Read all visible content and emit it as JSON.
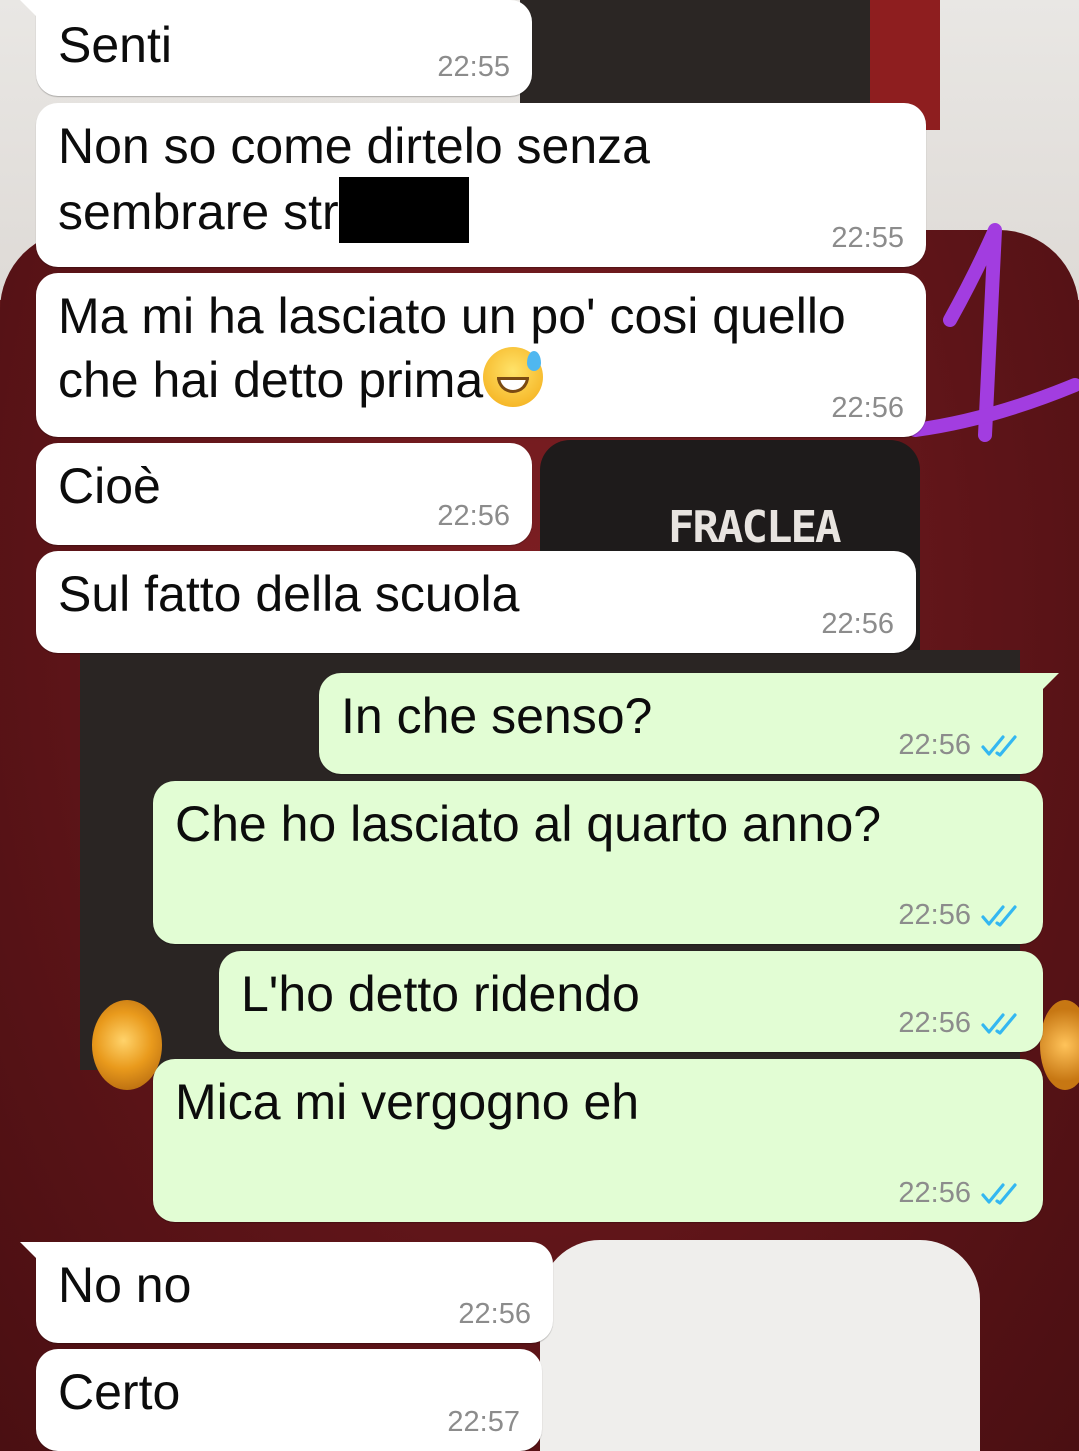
{
  "messages": [
    {
      "id": 1,
      "direction": "in",
      "text": "Senti",
      "time": "22:55"
    },
    {
      "id": 2,
      "direction": "in",
      "text_line1": "Non so come dirtelo senza",
      "text_line2": "sembrare str",
      "redacted": true,
      "time": "22:55"
    },
    {
      "id": 3,
      "direction": "in",
      "text_line1": "Ma mi ha lasciato un po' cosi quello",
      "text_line2": "che hai detto prima",
      "emoji": "grinning-sweat-emoji",
      "time": "22:56"
    },
    {
      "id": 4,
      "direction": "in",
      "text": "Cioè",
      "time": "22:56"
    },
    {
      "id": 5,
      "direction": "in",
      "text": "Sul fatto della scuola",
      "time": "22:56"
    },
    {
      "id": 6,
      "direction": "out",
      "text": "In che senso?",
      "time": "22:56",
      "status": "read"
    },
    {
      "id": 7,
      "direction": "out",
      "text": "Che ho lasciato al quarto anno?",
      "time": "22:56",
      "status": "read"
    },
    {
      "id": 8,
      "direction": "out",
      "text": "L'ho detto ridendo",
      "time": "22:56",
      "status": "read"
    },
    {
      "id": 9,
      "direction": "out",
      "text": "Mica mi vergogno eh",
      "time": "22:56",
      "status": "read"
    },
    {
      "id": 10,
      "direction": "in",
      "text": "No no",
      "time": "22:56"
    },
    {
      "id": 11,
      "direction": "in",
      "text": "Certo",
      "time": "22:57"
    }
  ],
  "wallpaper": {
    "sign_text": "FRACLEA"
  },
  "annotation": {
    "mark": "1",
    "color": "#a23de0"
  },
  "colors": {
    "incoming_bubble": "#ffffff",
    "outgoing_bubble": "#e2fdd4",
    "read_ticks": "#34b7f1",
    "time_text": "#8c8c8c"
  },
  "icons": {
    "read_status": "double-check-icon"
  }
}
